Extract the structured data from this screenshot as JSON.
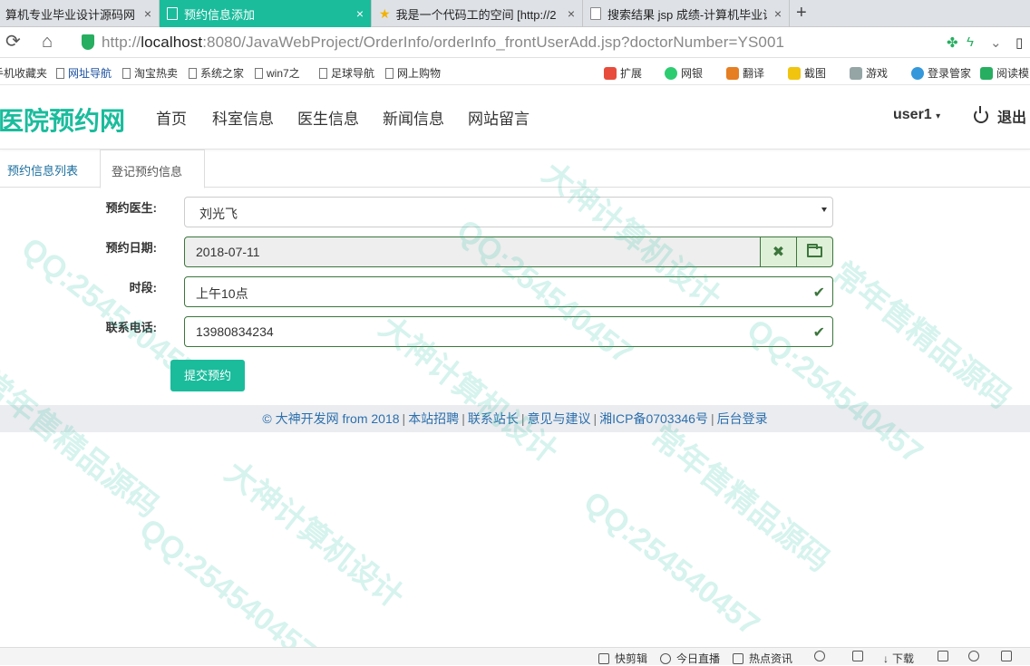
{
  "browser": {
    "tabs": [
      {
        "label": "算机专业毕业设计源码网",
        "close": "×"
      },
      {
        "label": "预约信息添加",
        "close": "×"
      },
      {
        "label": "我是一个代码工的空间 [http://2",
        "close": "×"
      },
      {
        "label": "搜索结果 jsp 成绩-计算机毕业设",
        "close": "×"
      }
    ],
    "new_tab": "+",
    "url_prefix": "http://",
    "url_host": "localhost",
    "url_rest": ":8080/JavaWebProject/OrderInfo/orderInfo_frontUserAdd.jsp?doctorNumber=YS001",
    "bookmarks": [
      "手机收藏夹",
      "网址导航",
      "淘宝热卖",
      "系统之家",
      "win7之",
      "足球导航",
      "网上购物"
    ],
    "toolbar_items": [
      "扩展",
      "网银",
      "翻译",
      "截图",
      "游戏",
      "登录管家",
      "阅读模"
    ]
  },
  "site": {
    "brand": "医院预约网",
    "nav": [
      "首页",
      "科室信息",
      "医生信息",
      "新闻信息",
      "网站留言"
    ],
    "user": "user1",
    "logout": "退出"
  },
  "subtabs": [
    "预约信息列表",
    "登记预约信息"
  ],
  "form": {
    "doctor_label": "预约医生:",
    "doctor_value": "刘光飞",
    "date_label": "预约日期:",
    "date_value": "2018-07-11",
    "period_label": "时段:",
    "period_value": "上午10点",
    "phone_label": "联系电话:",
    "phone_value": "13980834234",
    "submit": "提交预约",
    "clear_glyph": "✖"
  },
  "footer": {
    "items": [
      "© 大神开发网 from 2018",
      "本站招聘",
      "联系站长",
      "意见与建议",
      "湘ICP备0703346号",
      "后台登录"
    ],
    "separator": "|"
  },
  "statusbar": [
    "快剪辑",
    "今日直播",
    "热点资讯",
    "下载"
  ],
  "watermark": [
    "QQ:254540457",
    "大神计算机设计",
    "常年售精品源码"
  ],
  "colors": {
    "accent": "#1abc9c",
    "success": "#3c763d",
    "link": "#2c6fad"
  }
}
